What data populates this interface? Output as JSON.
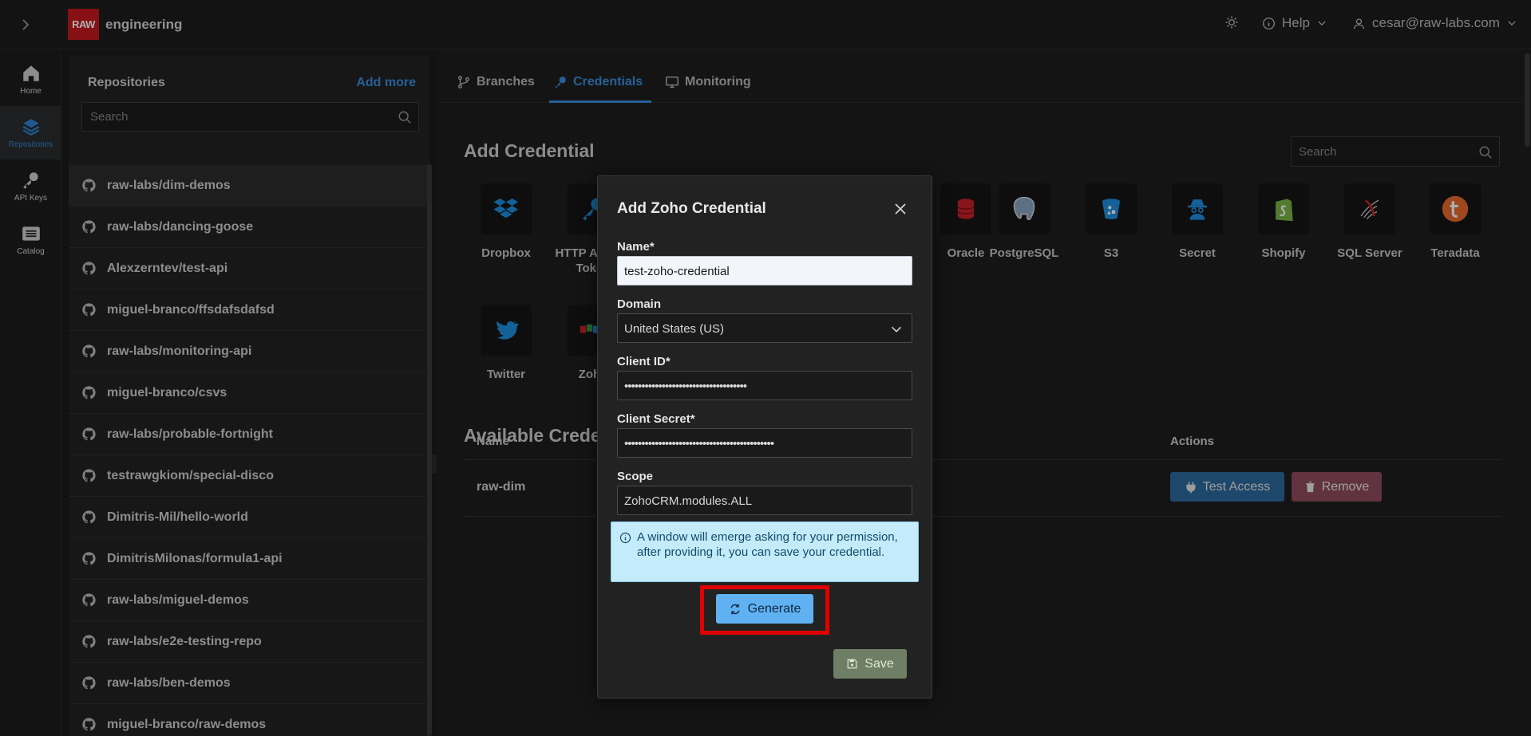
{
  "header": {
    "logo_text": "RAW",
    "org_name": "engineering",
    "help_label": "Help",
    "user_email": "cesar@raw-labs.com"
  },
  "rail": {
    "items": [
      {
        "label": "Home",
        "icon": "home-icon"
      },
      {
        "label": "Repositories",
        "icon": "layers-icon",
        "active": true
      },
      {
        "label": "API Keys",
        "icon": "key-icon"
      },
      {
        "label": "Catalog",
        "icon": "catalog-icon"
      }
    ]
  },
  "repos": {
    "title": "Repositories",
    "add_more": "Add more",
    "search_placeholder": "Search",
    "items": [
      "raw-labs/dim-demos",
      "raw-labs/dancing-goose",
      "Alexzerntev/test-api",
      "miguel-branco/ffsdafsdafsd",
      "raw-labs/monitoring-api",
      "miguel-branco/csvs",
      "raw-labs/probable-fortnight",
      "testrawgkiom/special-disco",
      "Dimitris-Mil/hello-world",
      "DimitrisMilonas/formula1-api",
      "raw-labs/miguel-demos",
      "raw-labs/e2e-testing-repo",
      "raw-labs/ben-demos",
      "miguel-branco/raw-demos"
    ]
  },
  "tabs": [
    {
      "label": "Branches",
      "icon": "git-branch-icon"
    },
    {
      "label": "Credentials",
      "icon": "key-icon",
      "active": true
    },
    {
      "label": "Monitoring",
      "icon": "monitor-icon"
    }
  ],
  "add_credential": {
    "title": "Add Credential",
    "search_placeholder": "Search",
    "tiles": [
      {
        "label": "Dropbox",
        "icon": "dropbox-icon"
      },
      {
        "label": "HTTP Access Token",
        "icon": "key-icon"
      },
      {
        "label": "Oracle",
        "icon": "oracle-icon"
      },
      {
        "label": "PostgreSQL",
        "icon": "postgresql-icon"
      },
      {
        "label": "S3",
        "icon": "s3-bucket-icon"
      },
      {
        "label": "Secret",
        "icon": "secret-agent-icon"
      },
      {
        "label": "Shopify",
        "icon": "shopify-icon"
      },
      {
        "label": "SQL Server",
        "icon": "sql-server-icon"
      },
      {
        "label": "Teradata",
        "icon": "teradata-icon"
      },
      {
        "label": "Twitter",
        "icon": "twitter-icon"
      },
      {
        "label": "Zoho",
        "icon": "zoho-icon"
      }
    ]
  },
  "available": {
    "title": "Available Credentials",
    "columns": {
      "name": "Name",
      "actions": "Actions"
    },
    "rows": [
      {
        "name": "raw-dim",
        "test_label": "Test Access",
        "remove_label": "Remove"
      }
    ]
  },
  "modal": {
    "title": "Add Zoho Credential",
    "name_label": "Name*",
    "name_value": "test-zoho-credential",
    "domain_label": "Domain",
    "domain_value": "United States (US)",
    "client_id_label": "Client ID*",
    "client_id_value": "••••••••••••••••••••••••••••••••••••",
    "client_secret_label": "Client Secret*",
    "client_secret_value": "••••••••••••••••••••••••••••••••••••••••••••",
    "scope_label": "Scope",
    "scope_value": "ZohoCRM.modules.ALL",
    "info_text": "A window will emerge asking for your permission, after providing it, you can save your credential.",
    "generate_label": "Generate",
    "save_label": "Save"
  },
  "colors": {
    "accent": "#3a8ee0",
    "brand_red": "#c6191c",
    "highlight": "#e00000",
    "info_bg": "#c3ebfa"
  }
}
